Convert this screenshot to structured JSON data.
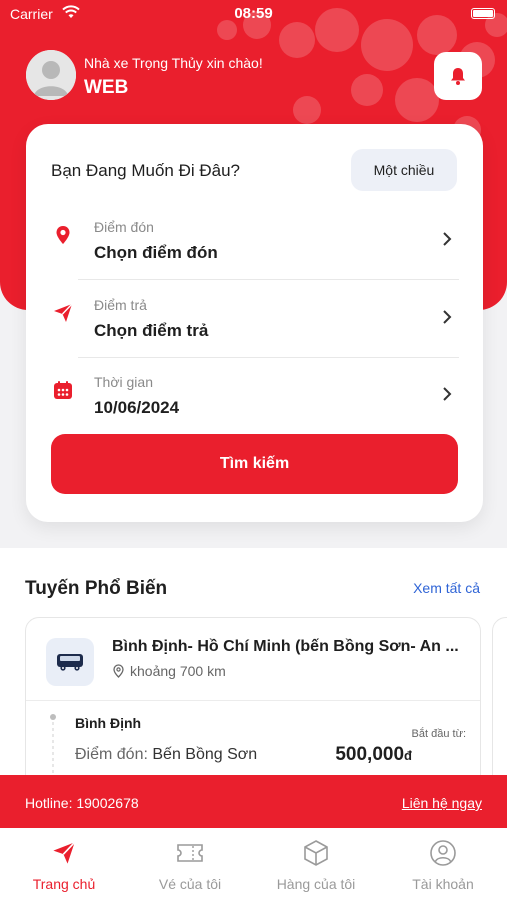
{
  "status_bar": {
    "carrier": "Carrier",
    "time": "08:59"
  },
  "header": {
    "greeting": "Nhà xe Trọng Thủy xin chào!",
    "username": "WEB"
  },
  "search_card": {
    "title": "Bạn Đang Muốn Đi Đâu?",
    "trip_type": "Một chiều",
    "pickup": {
      "label": "Điểm đón",
      "value": "Chọn điểm đón"
    },
    "dropoff": {
      "label": "Điểm trả",
      "value": "Chọn điểm trả"
    },
    "date": {
      "label": "Thời gian",
      "value": "10/06/2024"
    },
    "search_button": "Tìm kiếm"
  },
  "popular": {
    "title": "Tuyến Phổ Biến",
    "see_all": "Xem tất cả",
    "routes": [
      {
        "name": "Bình Định- Hồ Chí Minh (bến Bồng Sơn- An ...",
        "distance": "khoảng 700 km",
        "origin": "Bình Định",
        "pickup_label": "Điểm đón:",
        "pickup_value": "Bến Bồng Sơn",
        "start_from_label": "Bắt đầu từ:",
        "price": "500,000",
        "currency": "đ"
      }
    ]
  },
  "hotline": {
    "label": "Hotline: 19002678",
    "contact": "Liên hệ ngay"
  },
  "tabs": [
    {
      "label": "Trang chủ",
      "icon": "paper-plane-icon",
      "active": true
    },
    {
      "label": "Vé của tôi",
      "icon": "ticket-icon",
      "active": false
    },
    {
      "label": "Hàng của tôi",
      "icon": "package-icon",
      "active": false
    },
    {
      "label": "Tài khoản",
      "icon": "user-circle-icon",
      "active": false
    }
  ],
  "colors": {
    "brand": "#ea1f2d",
    "link": "#2f64d6",
    "chip": "#edf0f7"
  }
}
